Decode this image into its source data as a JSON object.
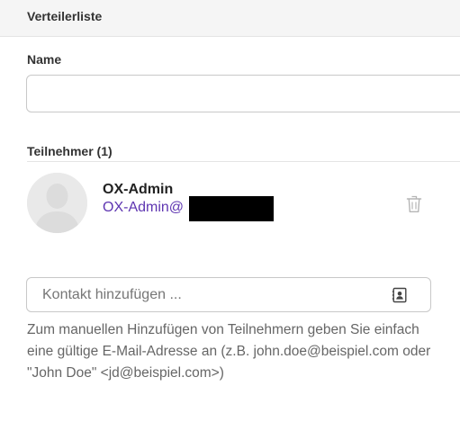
{
  "header": {
    "title": "Verteilerliste"
  },
  "form": {
    "name_label": "Name",
    "name_value": "",
    "participants_label": "Teilnehmer (1)"
  },
  "participants": [
    {
      "name": "OX-Admin",
      "email_visible": "OX-Admin@",
      "email_redacted": true
    }
  ],
  "add_contact": {
    "placeholder": "Kontakt hinzufügen ..."
  },
  "hint": {
    "text": "Zum manuellen Hinzufügen von Teilnehmern geben Sie einfach eine gültige E-Mail-Adresse an (z.B. john.doe@beispiel.com oder \"John Doe\" <jd@beispiel.com>)"
  },
  "icons": {
    "avatar": "default-user-avatar-icon",
    "delete": "trash-icon",
    "address_book": "address-book-icon"
  },
  "colors": {
    "email_link": "#5e35b1",
    "header_bg": "#f5f5f5",
    "hint_text": "#666666"
  }
}
